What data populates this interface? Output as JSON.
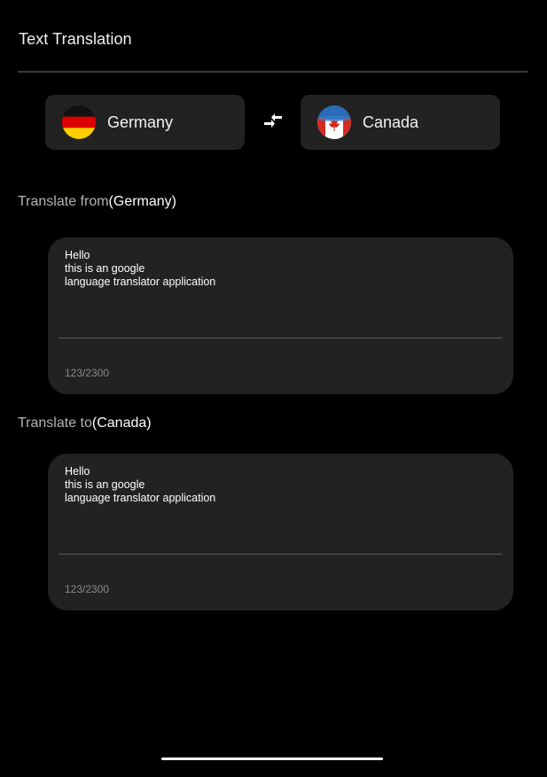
{
  "header": {
    "title": "Text Translation"
  },
  "languages": {
    "from": {
      "name": "Germany",
      "flag_icon": "germany-flag-icon"
    },
    "to": {
      "name": "Canada",
      "flag_icon": "canada-flag-icon"
    },
    "swap_icon": "swap-arrows-icon"
  },
  "sections": {
    "from": {
      "prefix": "Translate from",
      "lang": "(Germany)"
    },
    "to": {
      "prefix": "Translate to",
      "lang": "(Canada)"
    }
  },
  "input": {
    "text": "Hello\nthis is an google\nlanguage translator application",
    "char_count": "123/2300"
  },
  "output": {
    "text": "Hello\nthis is an google\nlanguage translator application",
    "char_count": "123/2300"
  },
  "colors": {
    "background": "#000000",
    "card": "#222222",
    "muted_text": "#b3b3b3",
    "counter_text": "#8a8a8a"
  }
}
